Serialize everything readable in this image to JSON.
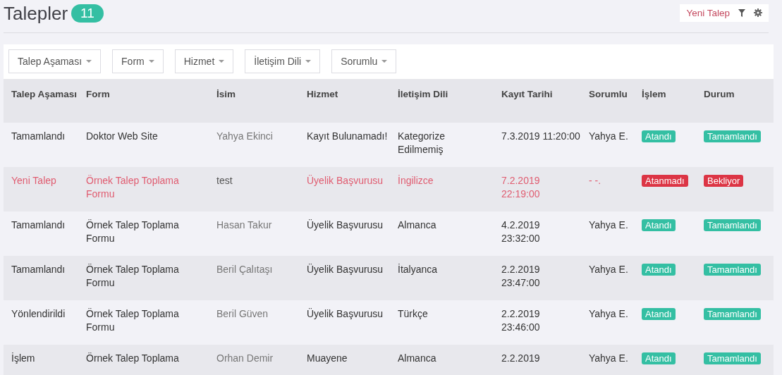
{
  "header": {
    "title": "Talepler",
    "count": "11",
    "new_button": "Yeni Talep"
  },
  "filters": [
    "Talep Aşaması",
    "Form",
    "Hizmet",
    "İletişim Dili",
    "Sorumlu"
  ],
  "table": {
    "columns": [
      "Talep Aşaması",
      "Form",
      "İsim",
      "Hizmet",
      "İletişim Dili",
      "Kayıt Tarihi",
      "Sorumlu",
      "İşlem",
      "Durum"
    ],
    "rows": [
      {
        "unread": false,
        "stage": "Tamamlandı",
        "form": "Doktor Web Site",
        "name": "Yahya Ekinci",
        "service": "Kayıt Bulunamadı!",
        "language": "Kategorize Edilmemiş",
        "date": "7.3.2019 11:20:00",
        "owner": "Yahya E.",
        "action": {
          "text": "Atandı",
          "color": "#34bfa3"
        },
        "status": {
          "text": "Tamamlandı",
          "color": "#34bfa3"
        }
      },
      {
        "unread": true,
        "stage": "Yeni Talep",
        "form": "Örnek Talep Toplama Formu",
        "name": "test",
        "service": "Üyelik Başvurusu",
        "language": "İngilizce",
        "date": "7.2.2019 22:19:00",
        "owner": "- -.",
        "action": {
          "text": "Atanmadı",
          "color": "#dc3545"
        },
        "status": {
          "text": "Bekliyor",
          "color": "#dc3545"
        }
      },
      {
        "unread": false,
        "stage": "Tamamlandı",
        "form": "Örnek Talep Toplama Formu",
        "name": "Hasan Takur",
        "service": "Üyelik Başvurusu",
        "language": "Almanca",
        "date": "4.2.2019 23:32:00",
        "owner": "Yahya E.",
        "action": {
          "text": "Atandı",
          "color": "#34bfa3"
        },
        "status": {
          "text": "Tamamlandı",
          "color": "#34bfa3"
        }
      },
      {
        "unread": false,
        "stage": "Tamamlandı",
        "form": "Örnek Talep Toplama Formu",
        "name": "Beril Çalıtaşı",
        "service": "Üyelik Başvurusu",
        "language": "İtalyanca",
        "date": "2.2.2019 23:47:00",
        "owner": "Yahya E.",
        "action": {
          "text": "Atandı",
          "color": "#34bfa3"
        },
        "status": {
          "text": "Tamamlandı",
          "color": "#34bfa3"
        }
      },
      {
        "unread": false,
        "stage": "Yönlendirildi",
        "form": "Örnek Talep Toplama Formu",
        "name": "Beril Güven",
        "service": "Üyelik Başvurusu",
        "language": "Türkçe",
        "date": "2.2.2019 23:46:00",
        "owner": "Yahya E.",
        "action": {
          "text": "Atandı",
          "color": "#34bfa3"
        },
        "status": {
          "text": "Tamamlandı",
          "color": "#34bfa3"
        }
      },
      {
        "unread": false,
        "stage": "İşlem",
        "form": "Örnek Talep Toplama",
        "name": "Orhan Demir",
        "service": "Muayene",
        "language": "Almanca",
        "date": "2.2.2019",
        "owner": "Yahya E.",
        "action": {
          "text": "Atandı",
          "color": "#34bfa3"
        },
        "status": {
          "text": "Tamamlandı",
          "color": "#34bfa3"
        }
      }
    ]
  }
}
